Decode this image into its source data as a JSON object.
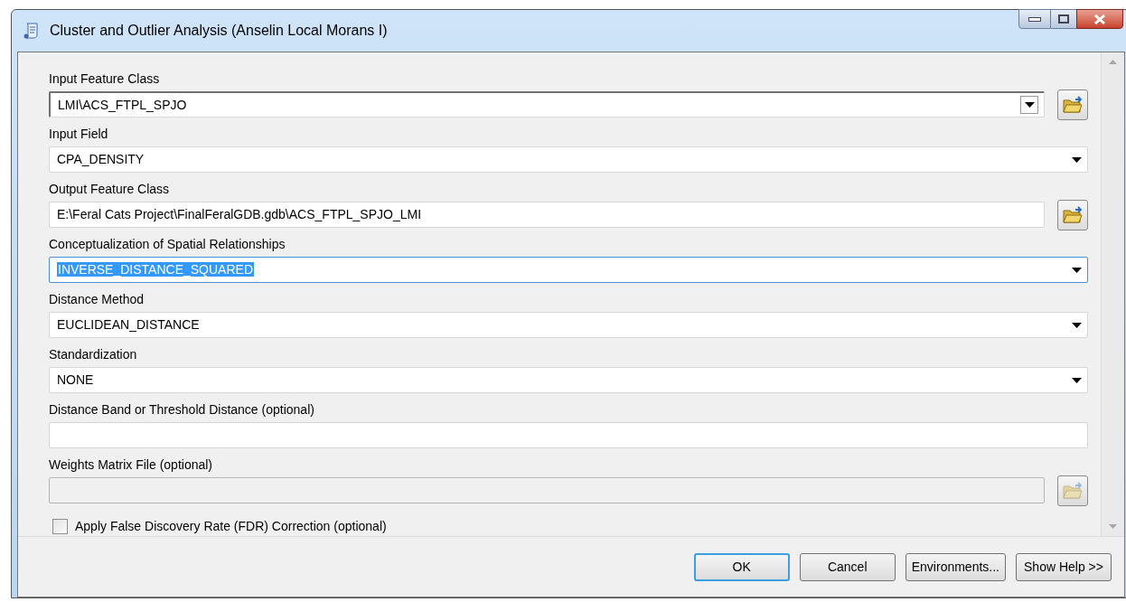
{
  "window": {
    "title": "Cluster and Outlier Analysis (Anselin Local Morans I)"
  },
  "parameters": [
    {
      "label": "Input Feature Class",
      "value": "LMI\\ACS_FTPL_SPJO",
      "kind": "combo",
      "browse": true,
      "disabled": false,
      "highlighted": false
    },
    {
      "label": "Input Field",
      "value": "CPA_DENSITY",
      "kind": "dropdown",
      "browse": false,
      "disabled": false,
      "highlighted": false
    },
    {
      "label": "Output Feature Class",
      "value": "E:\\Feral Cats Project\\FinalFeralGDB.gdb\\ACS_FTPL_SPJO_LMI",
      "kind": "text",
      "browse": true,
      "disabled": false,
      "highlighted": false
    },
    {
      "label": "Conceptualization of Spatial Relationships",
      "value": "INVERSE_DISTANCE_SQUARED",
      "kind": "dropdown",
      "browse": false,
      "disabled": false,
      "highlighted": true
    },
    {
      "label": "Distance Method",
      "value": "EUCLIDEAN_DISTANCE",
      "kind": "dropdown",
      "browse": false,
      "disabled": false,
      "highlighted": false
    },
    {
      "label": "Standardization",
      "value": "NONE",
      "kind": "dropdown",
      "browse": false,
      "disabled": false,
      "highlighted": false
    },
    {
      "label": "Distance Band or Threshold Distance (optional)",
      "kind": "text",
      "browse": false,
      "disabled": false,
      "highlighted": false
    },
    {
      "label": "Weights Matrix File (optional)",
      "kind": "text",
      "browse": true,
      "disabled": true,
      "highlighted": false
    }
  ],
  "fdr": {
    "label": "Apply False Discovery Rate (FDR) Correction (optional)",
    "checked": false
  },
  "buttons": [
    {
      "label": "OK",
      "default": true
    },
    {
      "label": "Cancel",
      "default": false
    },
    {
      "label": "Environments...",
      "default": false
    },
    {
      "label": "Show Help >>",
      "default": false
    }
  ]
}
